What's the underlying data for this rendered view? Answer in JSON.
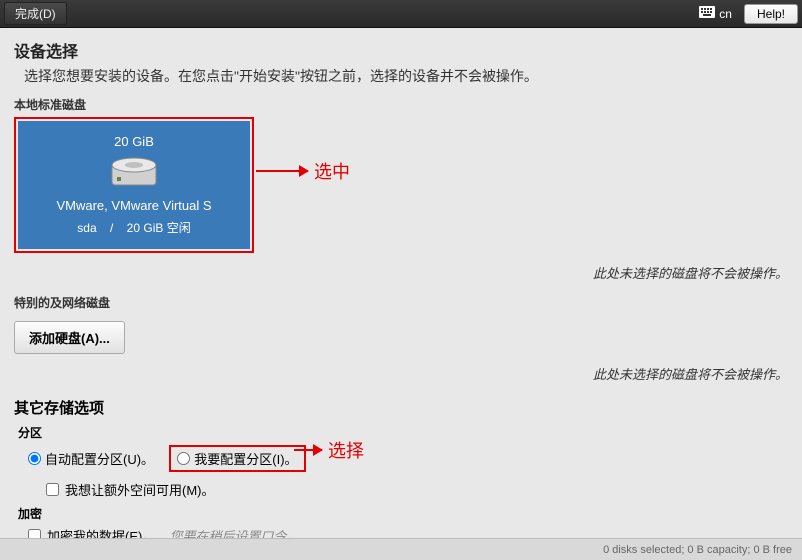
{
  "topbar": {
    "done_label": "完成(D)",
    "keyboard_layout": "cn",
    "help_label": "Help!"
  },
  "page": {
    "title": "设备选择",
    "subtitle": "选择您想要安装的设备。在您点击\"开始安装\"按钮之前，选择的设备并不会被操作。"
  },
  "local_disks": {
    "section_label": "本地标准磁盘",
    "disk": {
      "size": "20 GiB",
      "name": "VMware, VMware Virtual S",
      "device": "sda",
      "separator": "/",
      "free_text": "20 GiB 空闲"
    },
    "hint": "此处未选择的磁盘将不会被操作。"
  },
  "annotations": {
    "selected": "选中",
    "choose": "选择"
  },
  "special_disks": {
    "section_label": "特别的及网络磁盘",
    "add_button": "添加硬盘(A)...",
    "hint": "此处未选择的磁盘将不会被操作。"
  },
  "other_options": {
    "title": "其它存储选项",
    "partition_label": "分区",
    "auto_partition": "自动配置分区(U)。",
    "manual_partition": "我要配置分区(I)。",
    "extra_space": "我想让额外空间可用(M)。",
    "encrypt_label": "加密",
    "encrypt_data": "加密我的数据(E)。",
    "encrypt_hint": "您要在稍后设置口令。"
  },
  "statusbar": {
    "text": "0 disks selected;  0 B capacity;  0 B free"
  }
}
